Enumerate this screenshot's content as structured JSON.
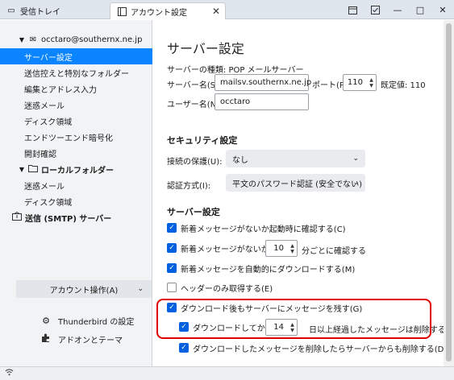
{
  "tabs": {
    "inbox_label": "受信トレイ",
    "settings_label": "アカウント設定"
  },
  "sidebar": {
    "account_email": "occtaro@southernx.ne.jp",
    "items": [
      "サーバー設定",
      "送信控えと特別なフォルダー",
      "編集とアドレス入力",
      "迷惑メール",
      "ディスク領域",
      "エンドツーエンド暗号化",
      "開封確認"
    ],
    "local_folder": "ローカルフォルダー",
    "local_items": [
      "迷惑メール",
      "ディスク領域"
    ],
    "smtp": "送信 (SMTP) サーバー",
    "account_actions": "アカウント操作(A)",
    "thunderbird_settings": "Thunderbird の設定",
    "addons": "アドオンとテーマ"
  },
  "main": {
    "page_title": "サーバー設定",
    "server_type": "サーバーの種類: POP メールサーバー",
    "server_name_label": "サーバー名(S):",
    "server_name_value": "mailsv.southernx.ne.jp",
    "port_label": "ポート(P):",
    "port_value": "110",
    "default_port": "既定値: 110",
    "username_label": "ユーザー名(N):",
    "username_value": "occtaro",
    "security_title": "セキュリティ設定",
    "conn_security_label": "接続の保護(U):",
    "conn_security_value": "なし",
    "auth_label": "認証方式(I):",
    "auth_value": "平文のパスワード認証 (安全でない)",
    "server_settings_title": "サーバー設定",
    "cb_check_startup": "新着メッセージがないか起動時に確認する(C)",
    "cb_check_every": "新着メッセージがないか(Y)",
    "check_interval": "10",
    "check_every_suffix": "分ごとに確認する",
    "cb_auto_download": "新着メッセージを自動的にダウンロードする(M)",
    "cb_headers_only": "ヘッダーのみ取得する(E)",
    "cb_leave_on_server": "ダウンロード後もサーバーにメッセージを残す(G)",
    "cb_delete_after": "ダウンロードしてから(O)",
    "delete_days": "14",
    "delete_after_suffix": "日以上経過したメッセージは削除する",
    "cb_delete_when_deleted": "ダウンロードしたメッセージを削除したらサーバーからも削除する(D)"
  },
  "colors": {
    "accent": "#0060df",
    "selected": "#0a84ff",
    "highlight": "#e00000"
  }
}
